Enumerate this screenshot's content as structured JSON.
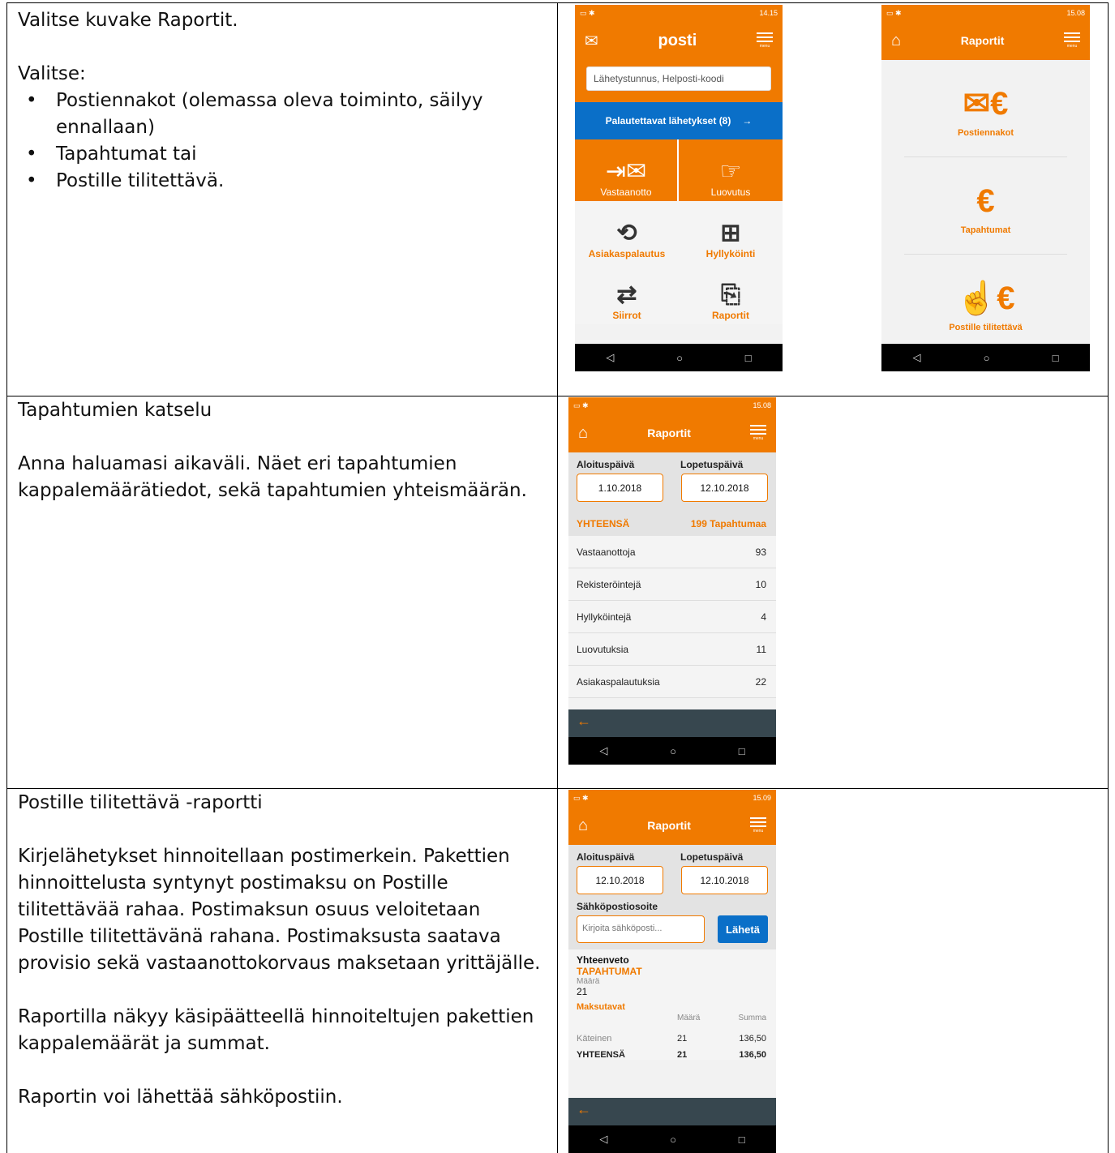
{
  "row1": {
    "intro": "Valitse kuvake Raportit.",
    "choose": "Valitse:",
    "bullets": [
      "Postiennakot (olemassa oleva toiminto, säilyy ennallaan)",
      "Tapahtumat tai",
      "Postille tilitettävä."
    ]
  },
  "row2": {
    "heading": "Tapahtumien katselu",
    "body": "Anna haluamasi aikaväli. Näet eri tapahtumien kappalemäärätiedot, sekä tapahtumien yhteismäärän."
  },
  "row3": {
    "heading": "Postille tilitettävä -raportti",
    "para1": "Kirjelähetykset hinnoitellaan postimerkein. Pakettien hinnoittelusta syntynyt postimaksu on Postille tilitettävää rahaa. Postimaksun osuus veloitetaan Postille tilitettävänä rahana. Postimaksusta saatava provisio sekä vastaanottokorvaus maksetaan yrittäjälle.",
    "para2": "Raportilla näkyy käsipäätteellä hinnoiteltujen pakettien kappalemäärät ja summat.",
    "para3": "Raportin voi lähettää sähköpostiin."
  },
  "phone_home": {
    "time": "14.15",
    "logo": "posti",
    "menu_label": "menu",
    "search_placeholder": "Lähetystunnus, Helposti-koodi",
    "returns_button": "Palautettavat lähetykset (8)",
    "tiles": [
      "Vastaanotto",
      "Luovutus",
      "Asiakaspalautus",
      "Hyllyköinti",
      "Siirrot",
      "Raportit"
    ]
  },
  "phone_reports": {
    "time": "15.08",
    "title": "Raportit",
    "menu_label": "menu",
    "items": [
      "Postiennakot",
      "Tapahtumat",
      "Postille tilitettävä"
    ]
  },
  "phone_events": {
    "time": "15.08",
    "title": "Raportit",
    "menu_label": "menu",
    "start_label": "Aloituspäivä",
    "end_label": "Lopetuspäivä",
    "start_date": "1.10.2018",
    "end_date": "12.10.2018",
    "total_label": "YHTEENSÄ",
    "total_value": "199 Tapahtumaa",
    "rows": [
      {
        "label": "Vastaanottoja",
        "value": "93"
      },
      {
        "label": "Rekisteröintejä",
        "value": "10"
      },
      {
        "label": "Hyllyköintejä",
        "value": "4"
      },
      {
        "label": "Luovutuksia",
        "value": "11"
      },
      {
        "label": "Asiakaspalautuksia",
        "value": "22"
      }
    ]
  },
  "phone_settle": {
    "time": "15.09",
    "title": "Raportit",
    "menu_label": "menu",
    "start_label": "Aloituspäivä",
    "end_label": "Lopetuspäivä",
    "start_date": "12.10.2018",
    "end_date": "12.10.2018",
    "email_label": "Sähköpostiosoite",
    "email_placeholder": "Kirjoita sähköposti...",
    "send_button": "Lähetä",
    "summary_title": "Yhteenveto",
    "events_label": "TAPAHTUMAT",
    "count_label": "Määrä",
    "count_value": "21",
    "payment_label": "Maksutavat",
    "col_count": "Määrä",
    "col_sum": "Summa",
    "cash_label": "Käteinen",
    "cash_count": "21",
    "cash_sum": "136,50",
    "total_label": "YHTEENSÄ",
    "total_count": "21",
    "total_sum": "136,50"
  }
}
